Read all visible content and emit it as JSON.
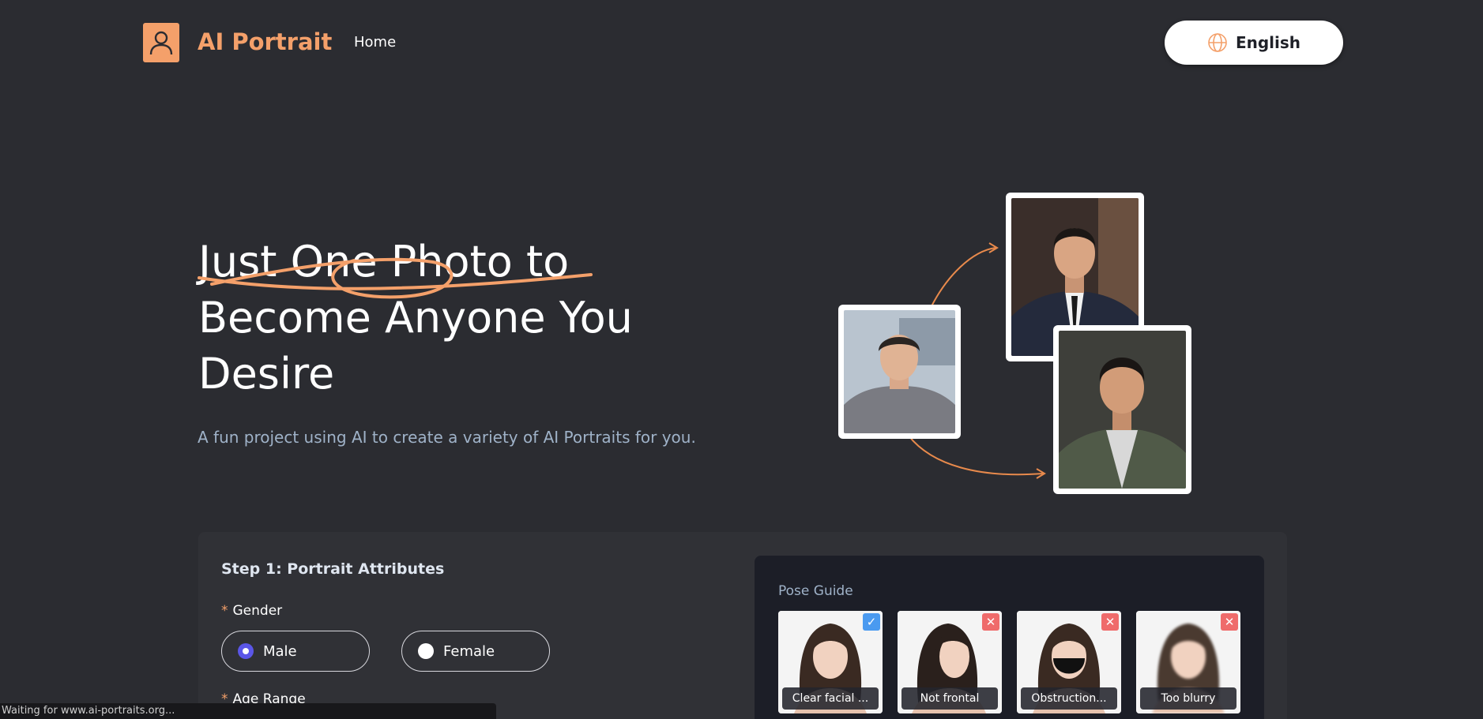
{
  "header": {
    "brand": "AI Portrait",
    "nav_home": "Home",
    "language": "English"
  },
  "hero": {
    "title_line1": "Just One Photo to",
    "title_line2": "Become Anyone You",
    "title_line3": "Desire",
    "subtitle": "A fun project using AI to create a variety of AI Portraits for you."
  },
  "form": {
    "step_title": "Step 1: Portrait Attributes",
    "required_mark": "*",
    "gender_label": "Gender",
    "gender_options": [
      "Male",
      "Female"
    ],
    "gender_selected": "Male",
    "age_label": "Age Range"
  },
  "pose_guide": {
    "title": "Pose Guide",
    "items": [
      {
        "caption": "Clear facial ...",
        "status": "ok",
        "badge": "✓"
      },
      {
        "caption": "Not frontal",
        "status": "bad",
        "badge": "✕"
      },
      {
        "caption": "Obstruction...",
        "status": "bad",
        "badge": "✕"
      },
      {
        "caption": "Too blurry",
        "status": "bad",
        "badge": "✕"
      }
    ]
  },
  "status_bar": "Waiting for www.ai-portraits.org...",
  "colors": {
    "accent": "#f4a06a",
    "background": "#2b2c31",
    "radio_checked": "#5b56e8",
    "ok_badge": "#4a9af0",
    "bad_badge": "#ef6b6b"
  }
}
